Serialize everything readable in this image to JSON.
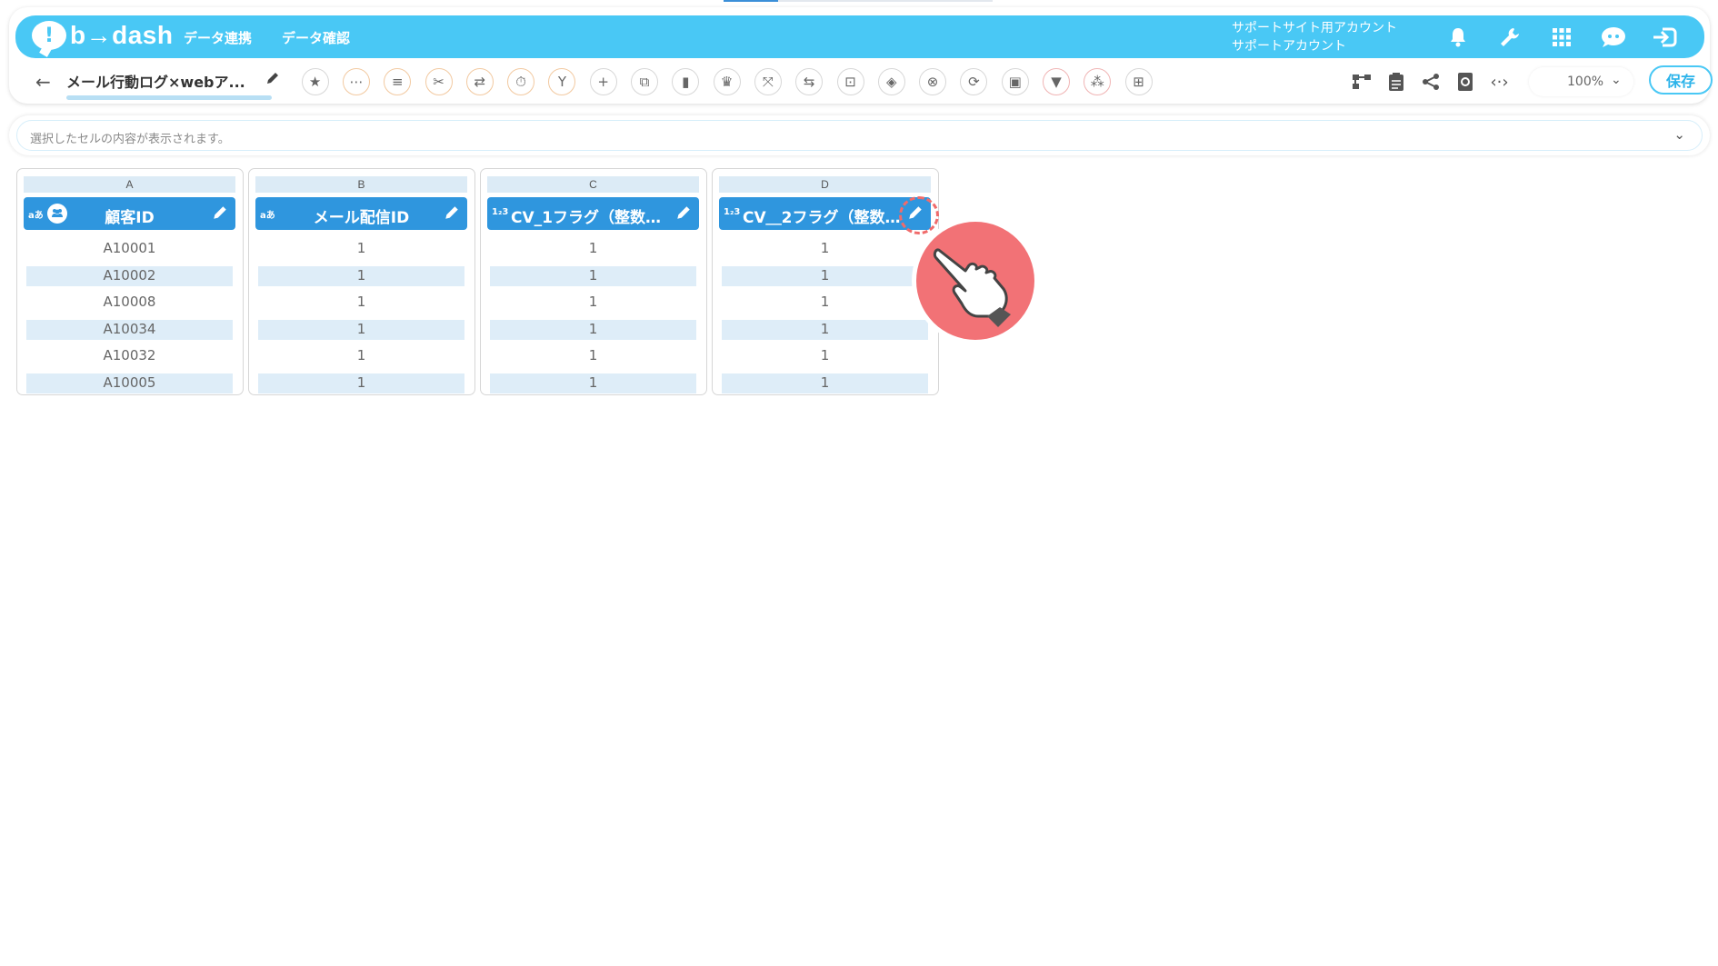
{
  "header": {
    "logo": "b→dash",
    "nav": [
      "データ連携",
      "データ確認"
    ],
    "account_line1": "サポートサイト用アカウント",
    "account_line2": "サポートアカウント",
    "icons": [
      "bell-icon",
      "wrench-icon",
      "apps-grid-icon",
      "chat-icon",
      "logout-icon"
    ]
  },
  "toolbar": {
    "title": "メール行動ログ×webア...",
    "tools": [
      "star",
      "more",
      "note",
      "cut",
      "merge",
      "timer",
      "branch",
      "add",
      "copy",
      "delete",
      "crown",
      "compress",
      "swap",
      "lock",
      "box",
      "close-circle",
      "transform",
      "frame",
      "filter",
      "grid-dots",
      "table"
    ],
    "zoom": "100%",
    "save": "保存"
  },
  "cellbar": {
    "placeholder": "選択したセルの内容が表示されます。"
  },
  "columns": [
    {
      "letter": "A",
      "type": "aあ",
      "name": "顧客ID",
      "rows": [
        "A10001",
        "A10002",
        "A10008",
        "A10034",
        "A10032",
        "A10005"
      ]
    },
    {
      "letter": "B",
      "type": "aあ",
      "name": "メール配信ID",
      "rows": [
        "1",
        "1",
        "1",
        "1",
        "1",
        "1"
      ]
    },
    {
      "letter": "C",
      "type": "1₂3",
      "name": "CV_1フラグ（整数…",
      "rows": [
        "1",
        "1",
        "1",
        "1",
        "1",
        "1"
      ]
    },
    {
      "letter": "D",
      "type": "1₂3",
      "name": "CV＿2フラグ（整数…",
      "rows": [
        "1",
        "1",
        "1",
        "1",
        "1",
        "1"
      ]
    }
  ],
  "colors": {
    "header": "#49c8f5",
    "column_header": "#2f96de",
    "row_alt": "#deedf8",
    "pointer": "#f27276"
  }
}
